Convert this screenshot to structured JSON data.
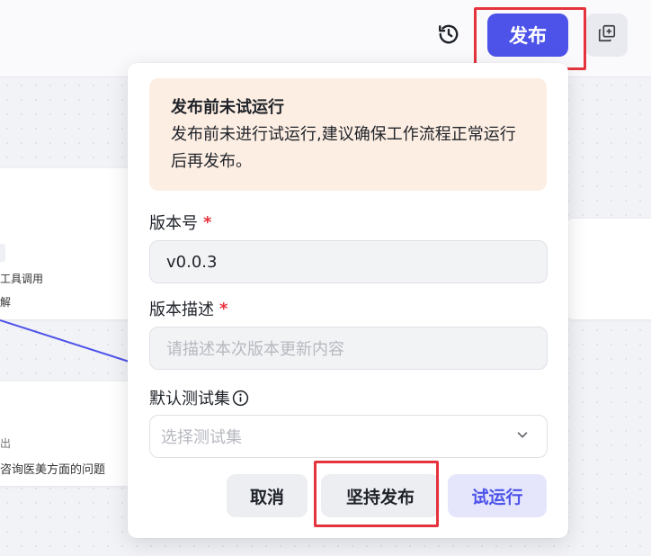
{
  "toolbar": {
    "publish_label": "发布"
  },
  "canvas": {
    "node_lines": [
      "工具调用",
      "解",
      "出",
      "咨询医美方面的问题"
    ]
  },
  "popup": {
    "warning": {
      "title": "发布前未试运行",
      "text": "发布前未进行试运行,建议确保工作流程正常运行后再发布。"
    },
    "version": {
      "label": "版本号",
      "required_mark": "*",
      "value": "v0.0.3"
    },
    "description": {
      "label": "版本描述",
      "required_mark": "*",
      "placeholder": "请描述本次版本更新内容"
    },
    "testset": {
      "label": "默认测试集",
      "placeholder": "选择测试集"
    },
    "buttons": {
      "cancel": "取消",
      "confirm_publish": "坚持发布",
      "test_run": "试运行"
    }
  },
  "colors": {
    "accent": "#4d53e8",
    "highlight": "#e5333d",
    "warning_bg": "#fdeee3"
  }
}
